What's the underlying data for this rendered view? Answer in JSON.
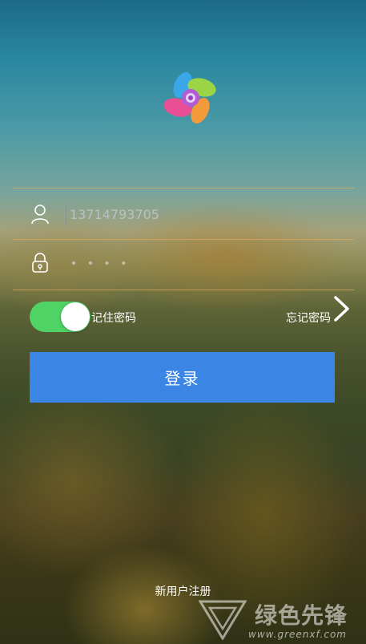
{
  "logo": {
    "icon": "pinwheel-logo-icon"
  },
  "login_form": {
    "phone_value": "13714793705",
    "password_mask": "• • • •",
    "remember_label": "记住密码",
    "remember_on": true,
    "forgot_label": "忘记密码",
    "login_label": "登录"
  },
  "footer": {
    "register_label": "新用户注册"
  },
  "watermark": {
    "title": "绿色先锋",
    "url": "www.greenxf.com"
  },
  "colors": {
    "toggle_on": "#4fd365",
    "button": "#3b86e4",
    "divider": "#e6aa5a"
  }
}
